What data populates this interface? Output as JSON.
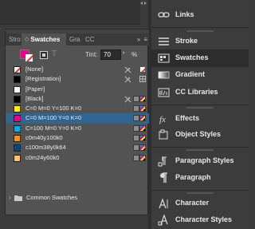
{
  "swatches_panel": {
    "tabs": {
      "stroke": "Stro",
      "swatches": "Swatches",
      "gradient": "Gra",
      "cc": "CC",
      "overflow": "»",
      "menu": "≡"
    },
    "tint_label": "Tint:",
    "tint_value": "70",
    "tint_arrow": "›",
    "percent": "%",
    "swatches": [
      {
        "name": "[None]",
        "color": "none",
        "selected": false
      },
      {
        "name": "[Registration]",
        "color": "#000000",
        "selected": false
      },
      {
        "name": "[Paper]",
        "color": "#ffffff",
        "selected": false
      },
      {
        "name": "[Black]",
        "color": "#000000",
        "selected": false
      },
      {
        "name": "C=0 M=0 Y=100 K=0",
        "color": "#fff200",
        "selected": false
      },
      {
        "name": "C=0 M=100 Y=0 K=0",
        "color": "#ec008c",
        "selected": true
      },
      {
        "name": "C=100 M=0 Y=0 K=0",
        "color": "#00aeef",
        "selected": false
      },
      {
        "name": "c0m40y100k0",
        "color": "#f7941d",
        "selected": false
      },
      {
        "name": "c100m38y0k64",
        "color": "#004a80",
        "selected": false
      },
      {
        "name": "c0m24y60k0",
        "color": "#fbc07a",
        "selected": false
      }
    ],
    "group_chevron": "›",
    "group_label": "Common Swatches"
  },
  "right_dock": {
    "items": [
      {
        "label": "Links",
        "icon": "links-icon"
      },
      {
        "label": "Stroke",
        "icon": "stroke-icon"
      },
      {
        "label": "Swatches",
        "icon": "swatches-icon",
        "selected": true
      },
      {
        "label": "Gradient",
        "icon": "gradient-icon"
      },
      {
        "label": "CC Libraries",
        "icon": "cc-libraries-icon"
      },
      {
        "label": "Effects",
        "icon": "effects-icon"
      },
      {
        "label": "Object Styles",
        "icon": "object-styles-icon"
      },
      {
        "label": "Paragraph Styles",
        "icon": "paragraph-styles-icon"
      },
      {
        "label": "Paragraph",
        "icon": "paragraph-icon"
      },
      {
        "label": "Character",
        "icon": "character-icon"
      },
      {
        "label": "Character Styles",
        "icon": "character-styles-icon"
      }
    ]
  },
  "colors": {
    "selection": "#316591",
    "panel": "#535353",
    "dock": "#3c3c3c"
  }
}
